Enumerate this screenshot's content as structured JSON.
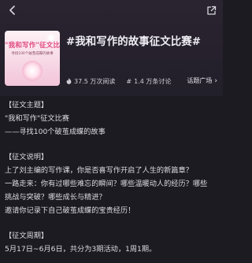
{
  "header": {
    "back_icon": "chevron-left-icon",
    "share_icon": "share-external-icon",
    "cover": {
      "line1": "\"我和写作\"征文比赛",
      "line2": "寻找100个破茧成蝶的故事"
    },
    "title": "#我和写作的故事征文比赛#",
    "stats": {
      "views_icon": "flame-icon",
      "views": "37.5 万次阅读",
      "discussions_icon": "hash-icon",
      "discussions": "1.4 万条讨论"
    },
    "plaza_link": "话题广场"
  },
  "content": {
    "theme_heading": "【征文主题】",
    "theme_lines": [
      "\"我和写作\"征文比赛",
      "——寻找100个破茧成蝶的故事"
    ],
    "desc_heading": "【征文说明】",
    "desc_lines": [
      "上了刘主编的写作课，你是否喜写作开启了人生的新篇章？",
      "一路走来：你有过哪些难忘的瞬间？哪些温暖动人的经历？哪些",
      "挑战与突破？哪些成长与精进？",
      "邀请你记录下自己破茧成蝶的宝贵经历！"
    ],
    "period_heading": "【征文周期】",
    "period_lines": [
      "5月17日~6月6日，共分为3期活动，1周1期。"
    ]
  },
  "colors": {
    "background": "#1c1b21",
    "cover_pink": "#e14a7f"
  }
}
